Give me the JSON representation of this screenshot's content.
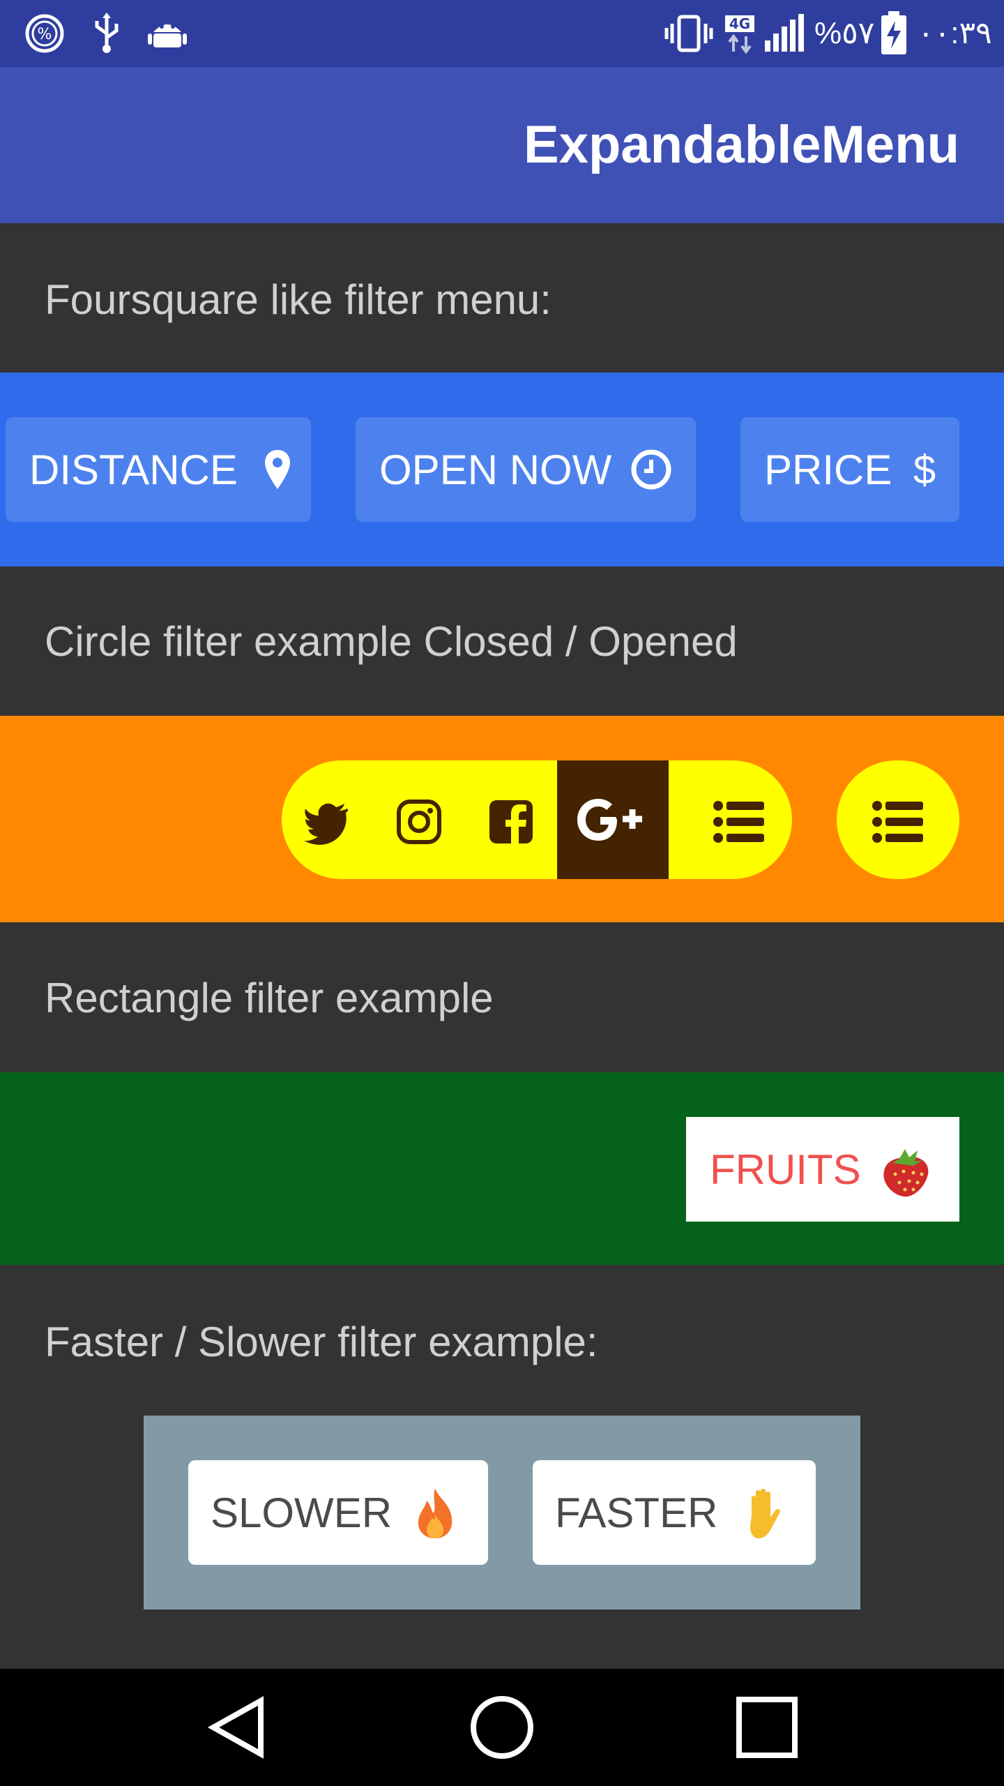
{
  "status_bar": {
    "battery_percent": "%٥٧",
    "time": "٠٠:٣٩",
    "network_type": "4G",
    "icons": [
      "percent-circle-icon",
      "usb-icon",
      "android-icon",
      "vibrate-icon",
      "network-4g-icon",
      "signal-icon",
      "battery-charging-icon"
    ]
  },
  "app_bar": {
    "title": "ExpandableMenu"
  },
  "sections": {
    "foursquare": {
      "label": "Foursquare like filter menu:",
      "buttons": [
        {
          "label": "DISTANCE",
          "icon": "map-marker-icon"
        },
        {
          "label": "OPEN NOW",
          "icon": "clock-icon"
        },
        {
          "label": "PRICE",
          "icon": "dollar-icon"
        }
      ],
      "colors": {
        "bar": "#2f6bea",
        "button": "#4d82ee"
      }
    },
    "circle": {
      "label": "Circle filter example Closed / Opened",
      "icons": [
        "twitter-icon",
        "instagram-icon",
        "facebook-icon",
        "google-plus-icon",
        "list-icon"
      ],
      "selected": "google-plus-icon",
      "colors": {
        "bar": "#ff8800",
        "pill": "#ffff00",
        "selected": "#442300"
      }
    },
    "rectangle": {
      "label": "Rectangle filter example",
      "button": {
        "label": "FRUITS",
        "icon": "strawberry-icon"
      },
      "colors": {
        "bar": "#05621a",
        "text": "#f0504e"
      }
    },
    "speed": {
      "label": "Faster / Slower filter example:",
      "buttons": [
        {
          "label": "SLOWER",
          "icon": "fire-icon"
        },
        {
          "label": "FASTER",
          "icon": "raised-hand-icon"
        }
      ],
      "colors": {
        "box": "#829aa6"
      }
    }
  },
  "nav_bar": {
    "icons": [
      "back-icon",
      "home-icon",
      "recents-icon"
    ]
  }
}
